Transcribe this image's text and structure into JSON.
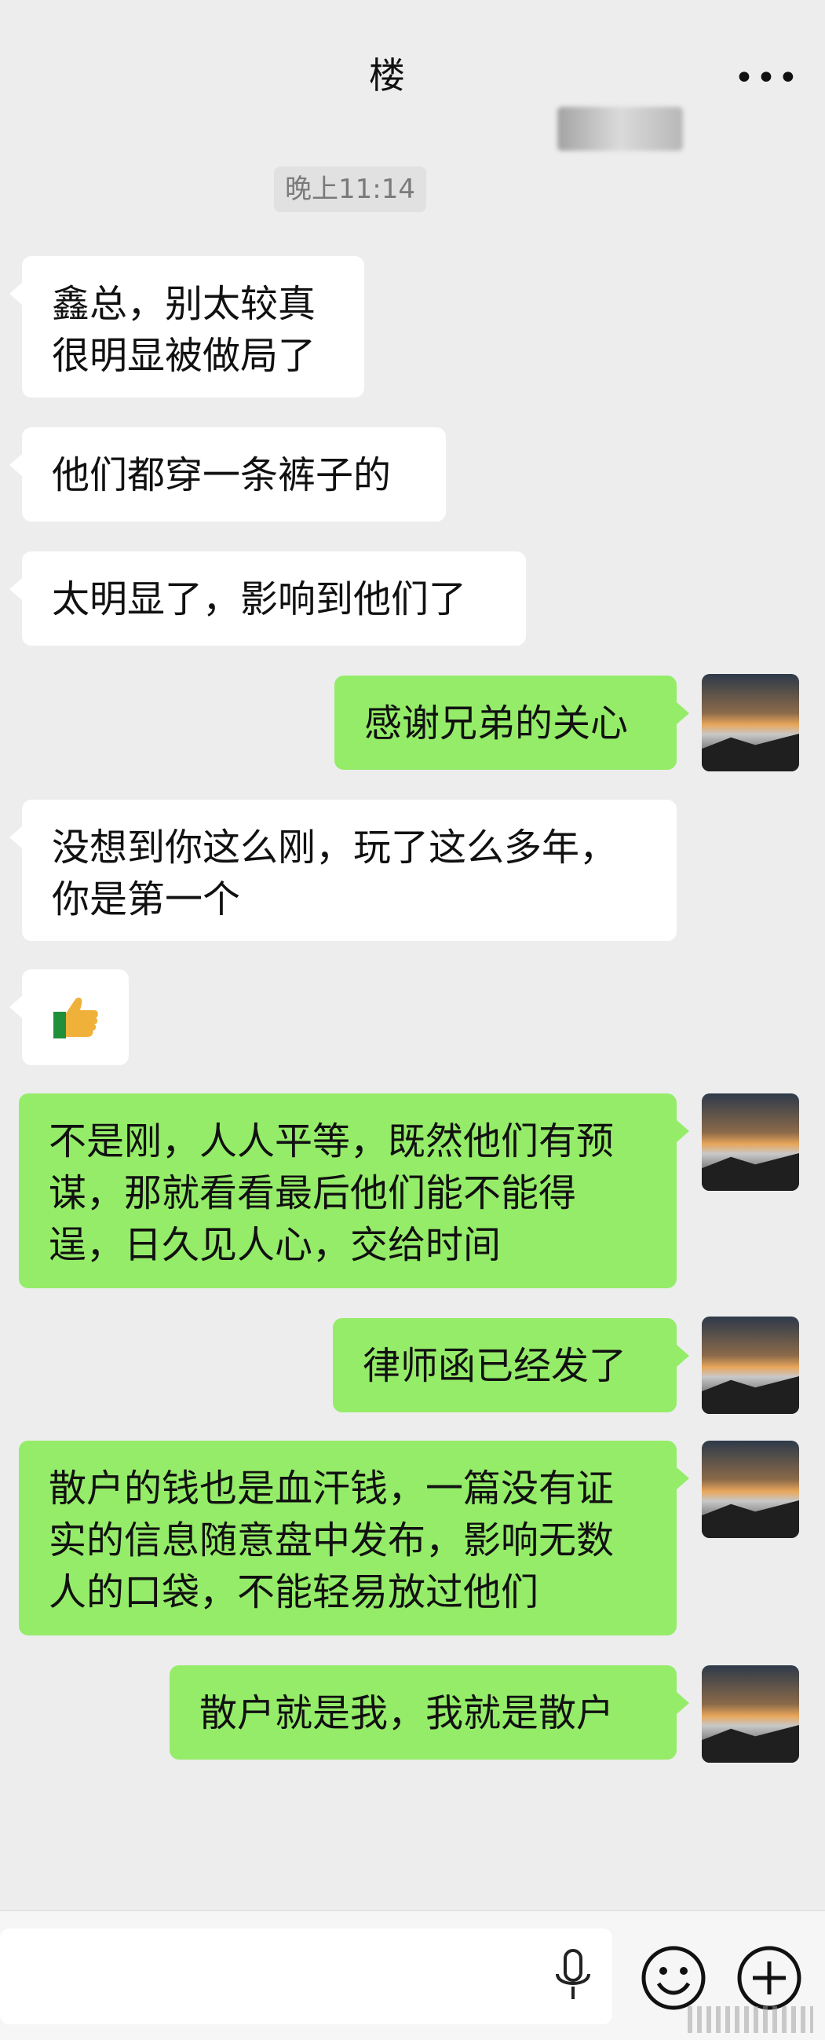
{
  "header": {
    "title": "楼",
    "more_icon": "more-dots-icon"
  },
  "timestamp": "晚上11:14",
  "messages": [
    {
      "side": "left",
      "text": "鑫总，别太较真\n很明显被做局了"
    },
    {
      "side": "left",
      "text": "他们都穿一条裤子的"
    },
    {
      "side": "left",
      "text": "太明显了，影响到他们了"
    },
    {
      "side": "right",
      "text": "感谢兄弟的关心"
    },
    {
      "side": "left",
      "text": "没想到你这么刚，玩了这么多年，\n你是第一个"
    },
    {
      "side": "left",
      "emoji": "thumbs-up-icon"
    },
    {
      "side": "right",
      "text": "不是刚，人人平等，既然他们有预\n谋，那就看看最后他们能不能得\n逞，日久见人心，交给时间"
    },
    {
      "side": "right",
      "text": "律师函已经发了"
    },
    {
      "side": "right",
      "text": "散户的钱也是血汗钱，一篇没有证\n实的信息随意盘中发布，影响无数\n人的口袋，不能轻易放过他们"
    },
    {
      "side": "right",
      "text": "散户就是我，我就是散户"
    }
  ],
  "input_bar": {
    "mic_icon": "microphone-icon",
    "emoji_icon": "emoji-icon",
    "plus_icon": "plus-icon"
  },
  "colors": {
    "background": "#ededed",
    "left_bubble": "#ffffff",
    "right_bubble": "#95ec69"
  }
}
